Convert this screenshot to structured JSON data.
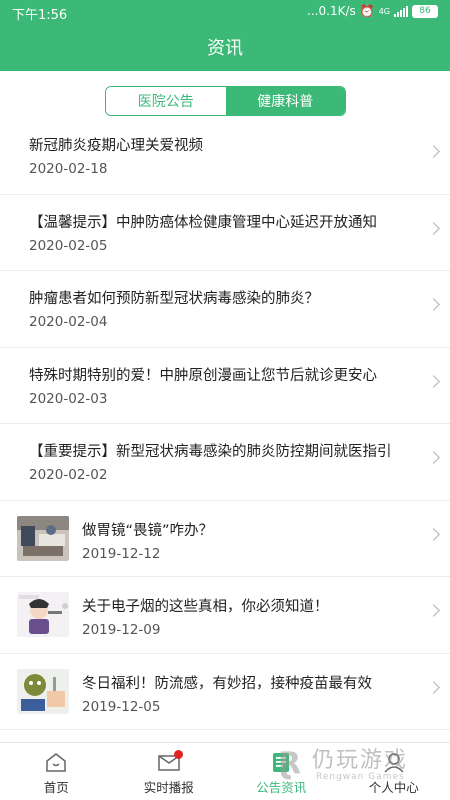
{
  "status_bar": {
    "time": "下午1:56",
    "network_speed": "...0.1K/s",
    "network_type": "4G",
    "battery": "86"
  },
  "header": {
    "title": "资讯"
  },
  "tabs": [
    {
      "label": "医院公告",
      "active": false
    },
    {
      "label": "健康科普",
      "active": true
    }
  ],
  "articles": [
    {
      "title": "新冠肺炎疫期心理关爱视频",
      "date": "2020-02-18"
    },
    {
      "title": "【温馨提示】中肿防癌体检健康管理中心延迟开放通知",
      "date": "2020-02-05"
    },
    {
      "title": "肿瘤患者如何预防新型冠状病毒感染的肺炎？",
      "date": "2020-02-04"
    },
    {
      "title": "特殊时期特别的爱！中肿原创漫画让您节后就诊更安心",
      "date": "2020-02-03"
    },
    {
      "title": "【重要提示】新型冠状病毒感染的肺炎防控期间就医指引",
      "date": "2020-02-02"
    },
    {
      "title": "做胃镜“畏镜”咋办？",
      "date": "2019-12-12",
      "thumb": "gastroscope-photo"
    },
    {
      "title": "关于电子烟的这些真相，你必须知道！",
      "date": "2019-12-09",
      "thumb": "e-cigarette-cartoon"
    },
    {
      "title": "冬日福利！防流感，有妙招，接种疫苗最有效",
      "date": "2019-12-05",
      "thumb": "flu-cartoon"
    }
  ],
  "bottom_nav": [
    {
      "label": "首页",
      "icon": "home-icon",
      "active": false
    },
    {
      "label": "实时播报",
      "icon": "broadcast-icon",
      "active": false,
      "badge": true
    },
    {
      "label": "公告资讯",
      "icon": "news-icon",
      "active": true
    },
    {
      "label": "个人中心",
      "icon": "user-icon",
      "active": false
    }
  ],
  "watermark": {
    "text": "仍玩游戏",
    "sub": "Rengwan Games"
  },
  "colors": {
    "brand_green": "#3cb977",
    "badge_red": "#e02323"
  }
}
